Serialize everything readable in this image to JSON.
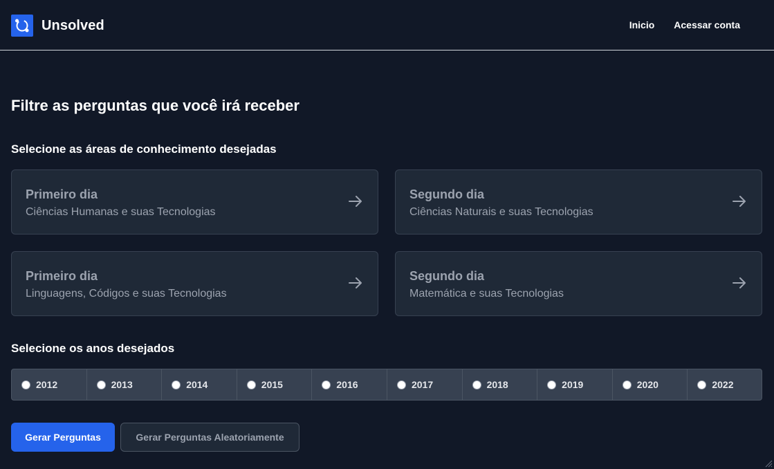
{
  "header": {
    "brand": "Unsolved",
    "nav": [
      "Inicio",
      "Acessar conta"
    ]
  },
  "main": {
    "title": "Filtre as perguntas que você irá receber",
    "areas_label": "Selecione as áreas de conhecimento desejadas",
    "areas": [
      {
        "day": "Primeiro dia",
        "subject": "Ciências Humanas e suas Tecnologias"
      },
      {
        "day": "Segundo dia",
        "subject": "Ciências Naturais e suas Tecnologias"
      },
      {
        "day": "Primeiro dia",
        "subject": "Linguagens, Códigos e suas Tecnologias"
      },
      {
        "day": "Segundo dia",
        "subject": "Matemática e suas Tecnologias"
      }
    ],
    "years_label": "Selecione os anos desejados",
    "years": [
      "2012",
      "2013",
      "2014",
      "2015",
      "2016",
      "2017",
      "2018",
      "2019",
      "2020",
      "2022"
    ],
    "buttons": {
      "generate": "Gerar Perguntas",
      "generate_random": "Gerar Perguntas Aleatoriamente"
    }
  },
  "colors": {
    "background": "#111827",
    "card": "#1f2937",
    "accent": "#2563eb"
  },
  "icons": {
    "logo": "unsolved-logo-icon",
    "card_arrow": "arrow-right-icon",
    "window_corner": "resize-grip-icon"
  }
}
